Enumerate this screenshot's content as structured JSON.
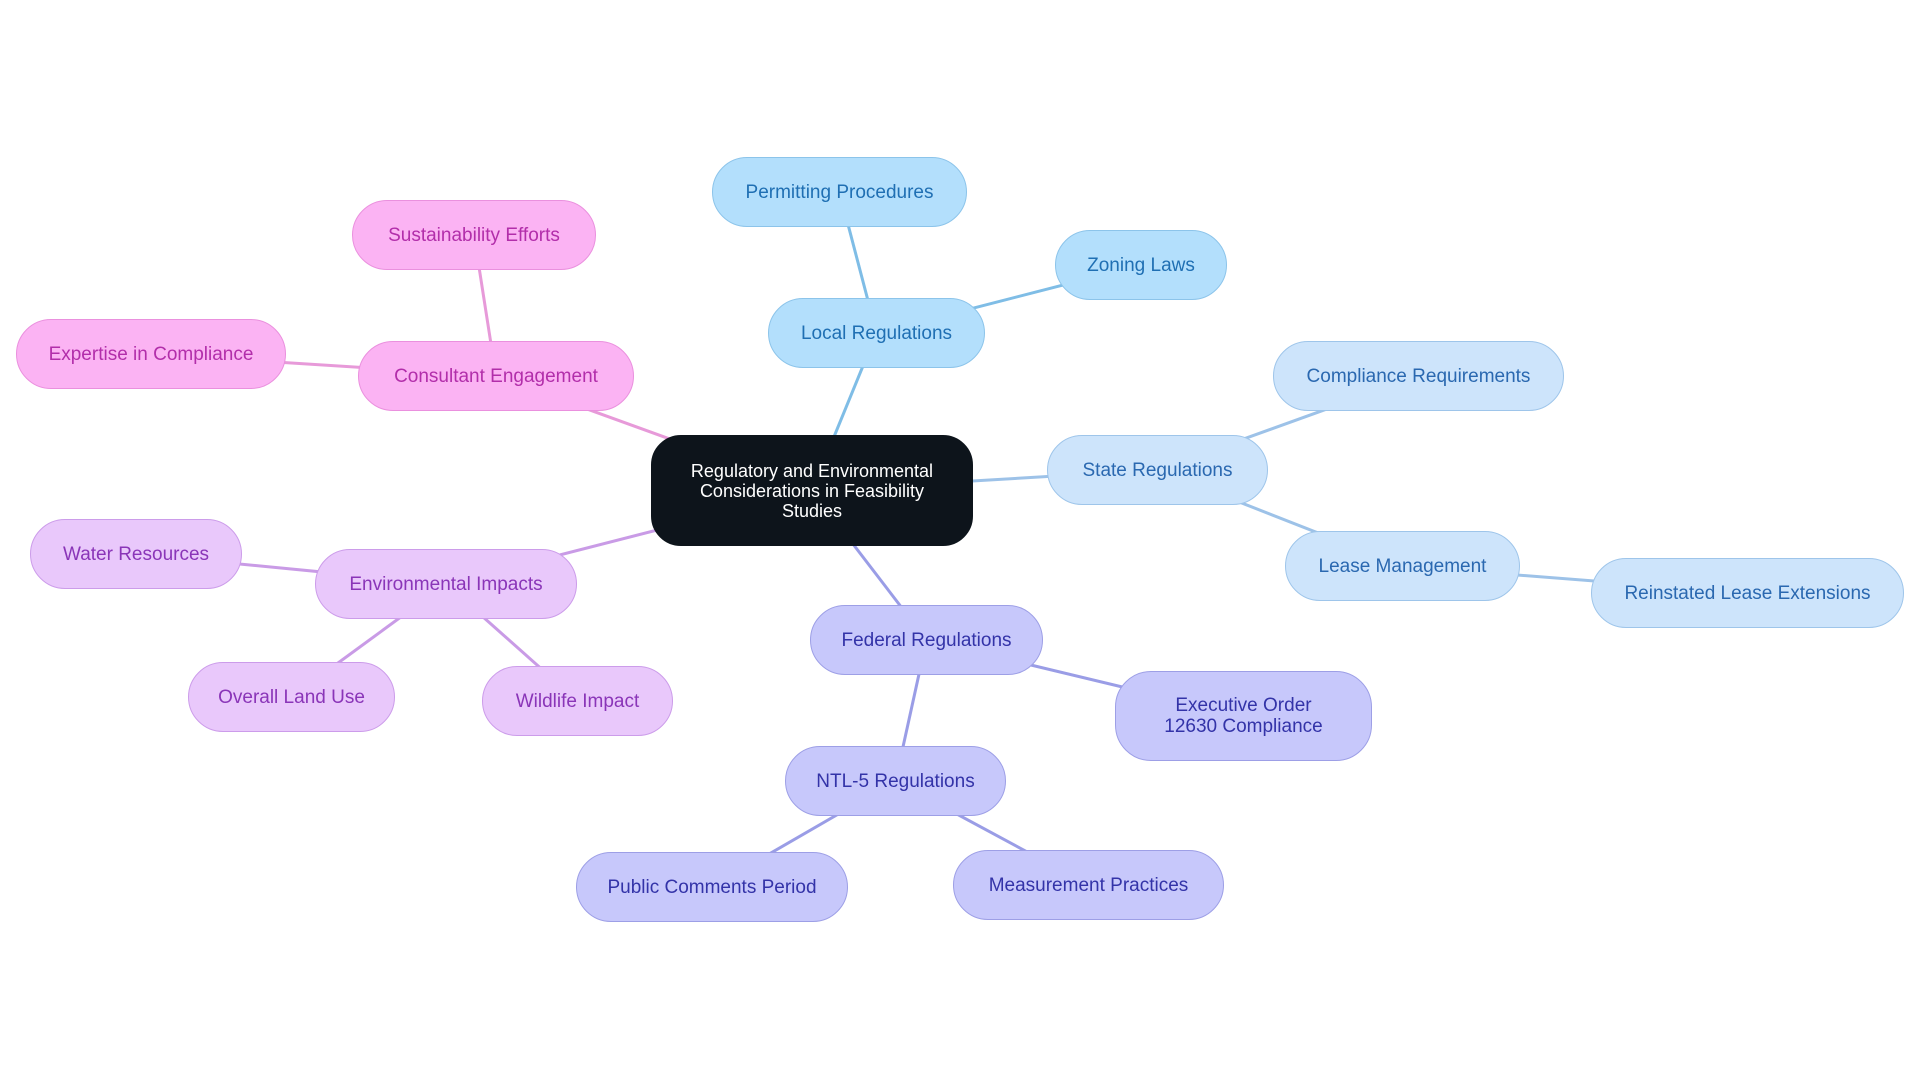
{
  "colors": {
    "root_bg": "#0d141b",
    "local": "#b3dffc",
    "state": "#cde4fb",
    "federal": "#c7c8fb",
    "environmental": "#e9c8fb",
    "consultant": "#fbb3f3",
    "edge_local": "#7fbde6",
    "edge_state": "#9dc2e8",
    "edge_federal": "#9a9de6",
    "edge_environmental": "#c99be6",
    "edge_consultant": "#e79ad9"
  },
  "mindmap": {
    "root": {
      "id": "root",
      "label": "Regulatory and Environmental Considerations in Feasibility Studies"
    },
    "nodes": [
      {
        "id": "local",
        "label": "Local Regulations",
        "parent": "root",
        "branch": "local"
      },
      {
        "id": "permitting",
        "label": "Permitting Procedures",
        "parent": "local",
        "branch": "local"
      },
      {
        "id": "zoning",
        "label": "Zoning Laws",
        "parent": "local",
        "branch": "local"
      },
      {
        "id": "state",
        "label": "State Regulations",
        "parent": "root",
        "branch": "state"
      },
      {
        "id": "compliance_req",
        "label": "Compliance Requirements",
        "parent": "state",
        "branch": "state"
      },
      {
        "id": "lease",
        "label": "Lease Management",
        "parent": "state",
        "branch": "state"
      },
      {
        "id": "reinstated",
        "label": "Reinstated Lease Extensions",
        "parent": "lease",
        "branch": "state"
      },
      {
        "id": "federal",
        "label": "Federal Regulations",
        "parent": "root",
        "branch": "fed"
      },
      {
        "id": "eo",
        "label": "Executive Order 12630 Compliance",
        "parent": "federal",
        "branch": "fed"
      },
      {
        "id": "ntl5",
        "label": "NTL-5 Regulations",
        "parent": "federal",
        "branch": "fed"
      },
      {
        "id": "public",
        "label": "Public Comments Period",
        "parent": "ntl5",
        "branch": "fed"
      },
      {
        "id": "measure",
        "label": "Measurement Practices",
        "parent": "ntl5",
        "branch": "fed"
      },
      {
        "id": "env",
        "label": "Environmental Impacts",
        "parent": "root",
        "branch": "env"
      },
      {
        "id": "water",
        "label": "Water Resources",
        "parent": "env",
        "branch": "env"
      },
      {
        "id": "landuse",
        "label": "Overall Land Use",
        "parent": "env",
        "branch": "env"
      },
      {
        "id": "wildlife",
        "label": "Wildlife Impact",
        "parent": "env",
        "branch": "env"
      },
      {
        "id": "consult",
        "label": "Consultant Engagement",
        "parent": "root",
        "branch": "cons"
      },
      {
        "id": "sustain",
        "label": "Sustainability Efforts",
        "parent": "consult",
        "branch": "cons"
      },
      {
        "id": "expertise",
        "label": "Expertise in Compliance",
        "parent": "consult",
        "branch": "cons"
      }
    ]
  }
}
